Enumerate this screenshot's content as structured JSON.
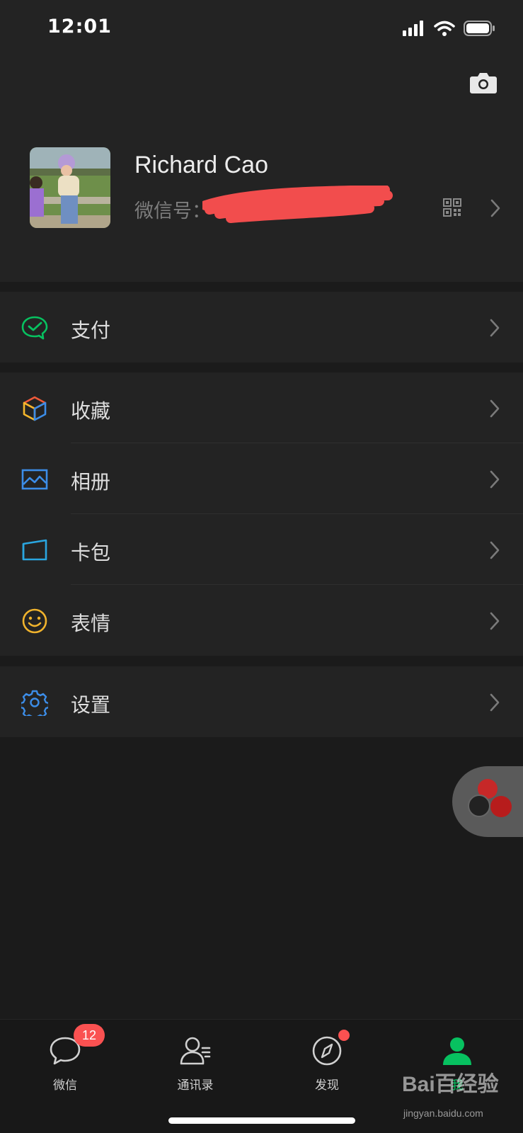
{
  "status_bar": {
    "time": "12:01"
  },
  "profile": {
    "name": "Richard Cao",
    "wechat_id_label": "微信号：",
    "wechat_id_value": ""
  },
  "groups": [
    {
      "items": [
        {
          "label": "支付",
          "icon": "wechat-pay-icon",
          "color": "#07c160"
        }
      ]
    },
    {
      "items": [
        {
          "label": "收藏",
          "icon": "favorites-cube-icon",
          "color": "#e86a3c"
        },
        {
          "label": "相册",
          "icon": "album-picture-icon",
          "color": "#2f8ee8"
        },
        {
          "label": "卡包",
          "icon": "card-wallet-icon",
          "color": "#2f8ee8"
        },
        {
          "label": "表情",
          "icon": "sticker-smile-icon",
          "color": "#f0b32d"
        }
      ]
    },
    {
      "items": [
        {
          "label": "设置",
          "icon": "settings-gear-icon",
          "color": "#2f8ee8"
        }
      ]
    }
  ],
  "tabbar": {
    "tabs": [
      {
        "label": "微信",
        "icon": "chat-bubble-icon",
        "badge": "12"
      },
      {
        "label": "通讯录",
        "icon": "contacts-icon"
      },
      {
        "label": "发现",
        "icon": "compass-icon",
        "dot": true
      },
      {
        "label": "我",
        "icon": "me-person-icon",
        "active": true
      }
    ]
  },
  "watermark": {
    "logo": "Bai百经验",
    "url": "jingyan.baidu.com"
  },
  "colors": {
    "accent": "#07c160",
    "badge": "#fa5151",
    "background": "#1b1b1b",
    "panel": "#232323"
  }
}
